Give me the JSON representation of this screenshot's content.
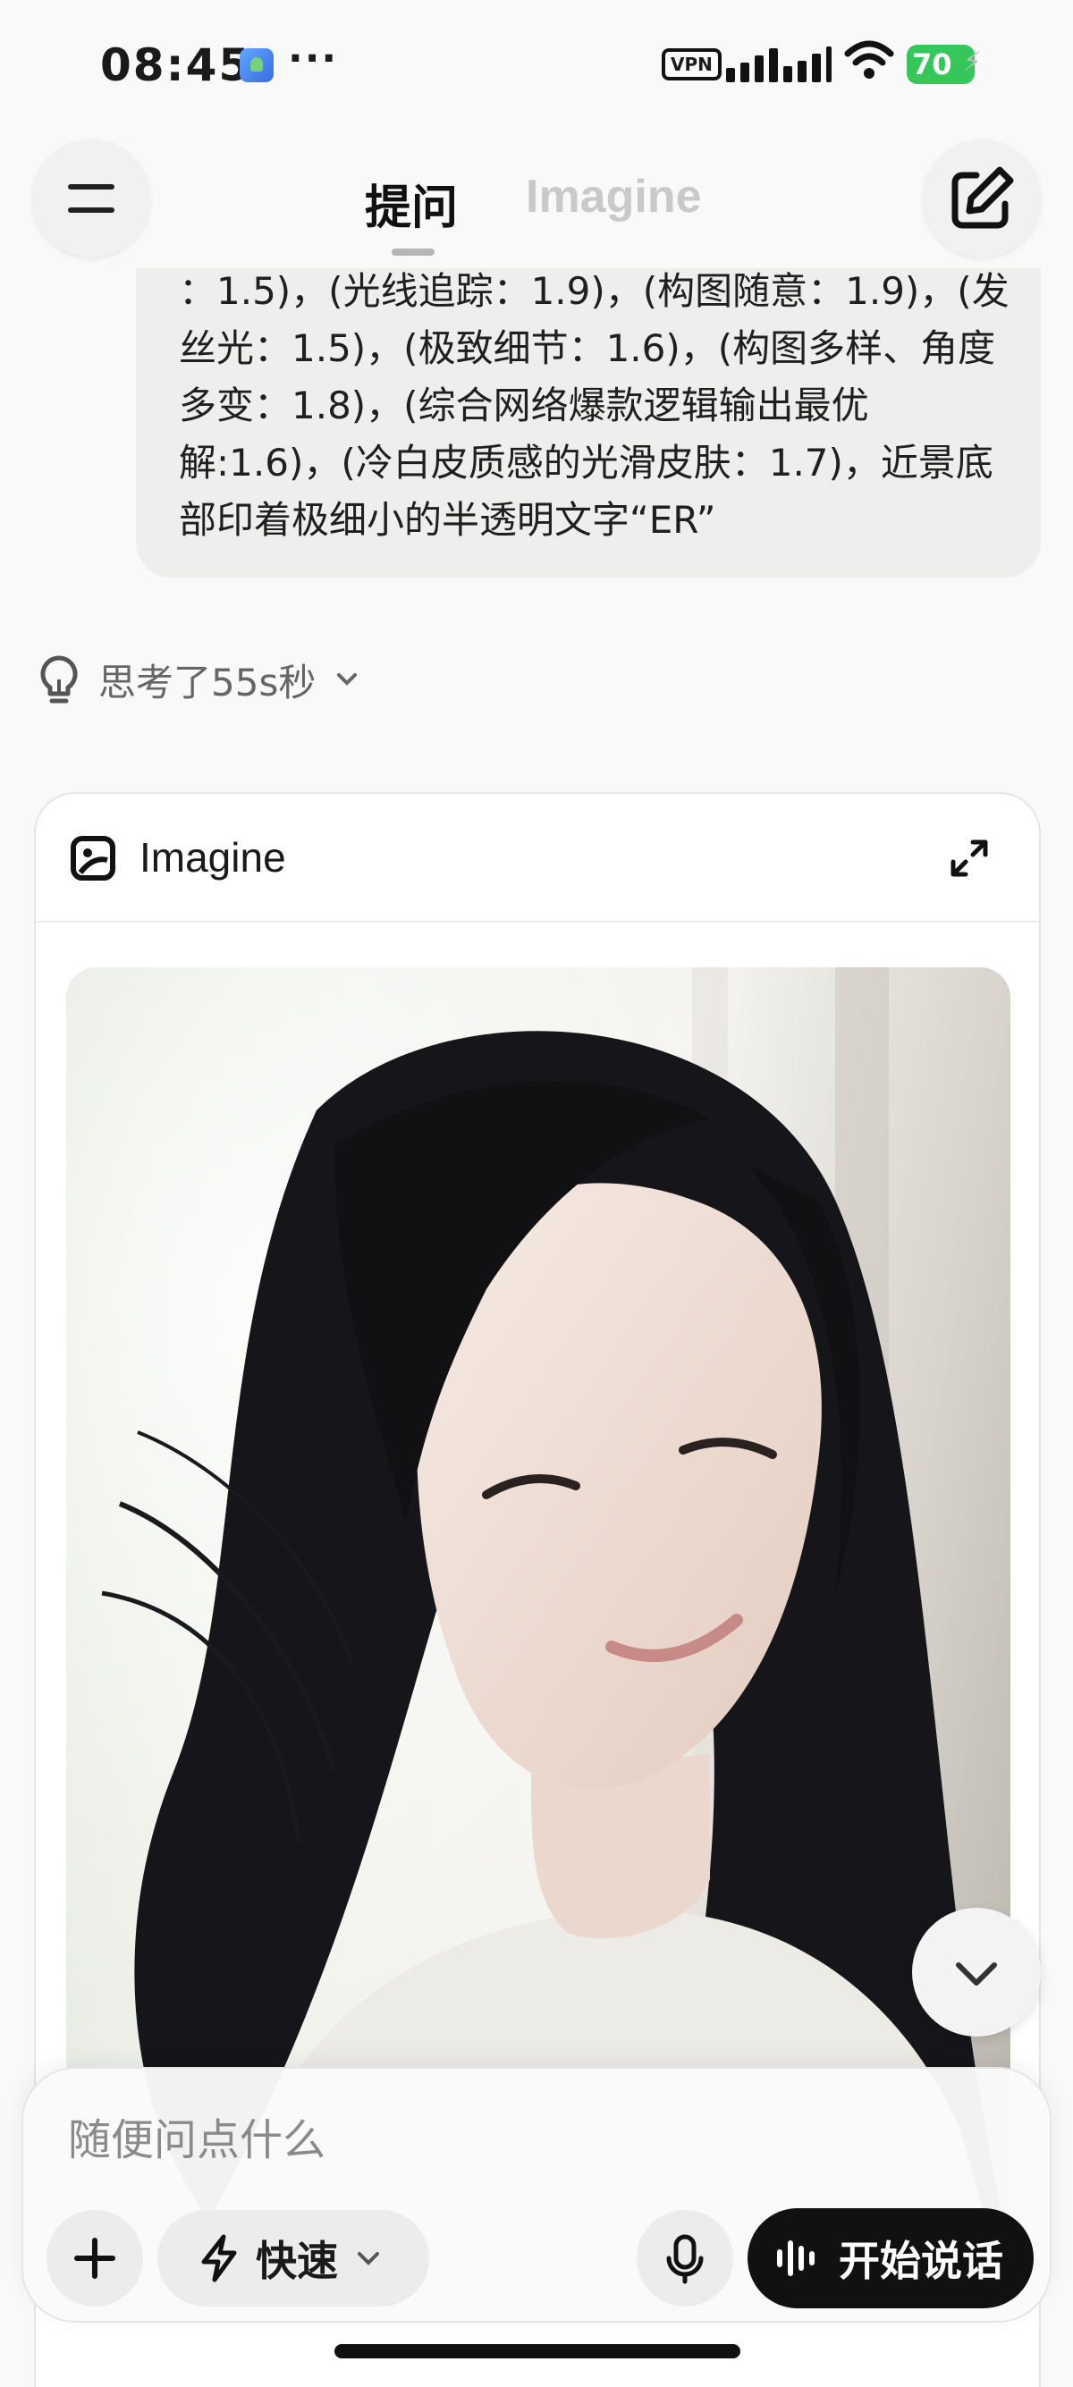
{
  "status_bar": {
    "time": "08:45",
    "more": "···",
    "vpn": "VPN",
    "battery": "70",
    "battery_color": "#35c759"
  },
  "nav": {
    "tabs": [
      {
        "label": "提问",
        "active": true
      },
      {
        "label": "Imagine",
        "active": false
      }
    ],
    "menu_icon": "menu-icon",
    "compose_icon": "compose-icon"
  },
  "prompt": {
    "text": "：1.5)，(光线追踪：1.9)，(构图随意：1.9)，(发丝光：1.5)，(极致细节：1.6)，(构图多样、角度多变：1.8)，(综合网络爆款逻辑输出最优解:1.6)，(冷白皮质感的光滑皮肤：1.7)，近景底部印着极细小的半透明文字“ER”"
  },
  "thought": {
    "label": "思考了55s秒",
    "icon": "lightbulb-icon"
  },
  "imagine_card": {
    "title": "Imagine",
    "icon": "imagine-icon",
    "expand_icon": "expand-icon"
  },
  "composer": {
    "placeholder": "随便问点什么",
    "mode_label": "快速",
    "talk_label": "开始说话"
  }
}
